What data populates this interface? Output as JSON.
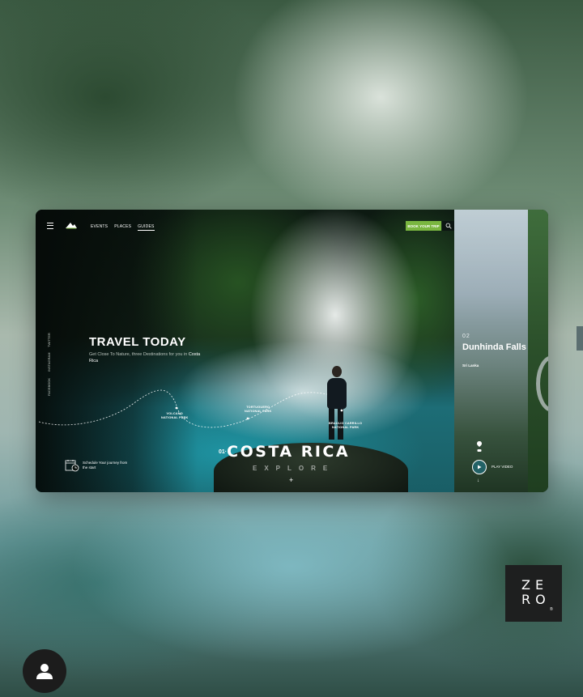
{
  "nav": {
    "links": [
      "EVENTS",
      "PLACES",
      "GUIDES"
    ],
    "book_label": "BOOK YOUR TRIP"
  },
  "social": [
    "FACEBOOK",
    "INSTAGRAM",
    "TWITTER"
  ],
  "hero": {
    "title": "TRAVEL TODAY",
    "subtitle": "Get Close To Nature, three Destinations for you in",
    "subtitle_highlight": "Costa Rica"
  },
  "parks": [
    {
      "name": "VOLCANO\nNATIONAL PARK"
    },
    {
      "name": "TORTUGUERO\nNATIONAL PARK"
    },
    {
      "name": "BRAULIO CARRILLO\nNATIONAL PARK"
    }
  ],
  "destination": {
    "number": "01·",
    "name": "COSTA RICA",
    "action": "EXPLORE"
  },
  "schedule": {
    "text": "Schedule Your journey from the start"
  },
  "next": {
    "number": "02",
    "title": "Dunhinda Falls",
    "country": "Sri Lanka",
    "play_label": "PLAY VIDEO"
  },
  "brand": {
    "logo_text": "ZE\nRO",
    "reg": "®"
  },
  "icons": {
    "menu": "menu-icon",
    "logo": "mountain-logo-icon",
    "search": "search-icon",
    "schedule": "calendar-icon",
    "pin": "location-pin-icon",
    "play": "play-icon",
    "arrow": "arrow-down-icon",
    "avatar": "user-avatar-icon"
  },
  "colors": {
    "accent": "#7ab640",
    "dark": "#0b1410"
  }
}
